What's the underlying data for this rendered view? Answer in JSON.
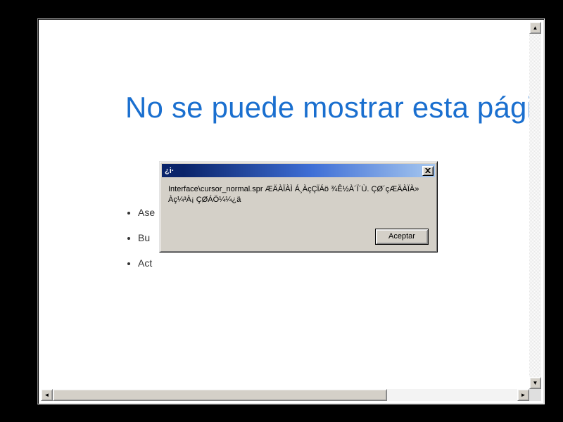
{
  "page": {
    "heading": "No se puede mostrar esta página",
    "bullets": [
      "Ase",
      "Bu",
      "Act"
    ]
  },
  "dialog": {
    "title": "¿i·",
    "message": "Interface\\cursor_normal.spr ÆÄÀÏÀÌ Á¸ÀçÇÏÁö ¾Ê½À´Ï´Ù. ÇØ´çÆÄÀÏÀ» Àç¼³À¡ ÇØÁÖ¼¼¿ä",
    "ok_label": "Aceptar"
  }
}
